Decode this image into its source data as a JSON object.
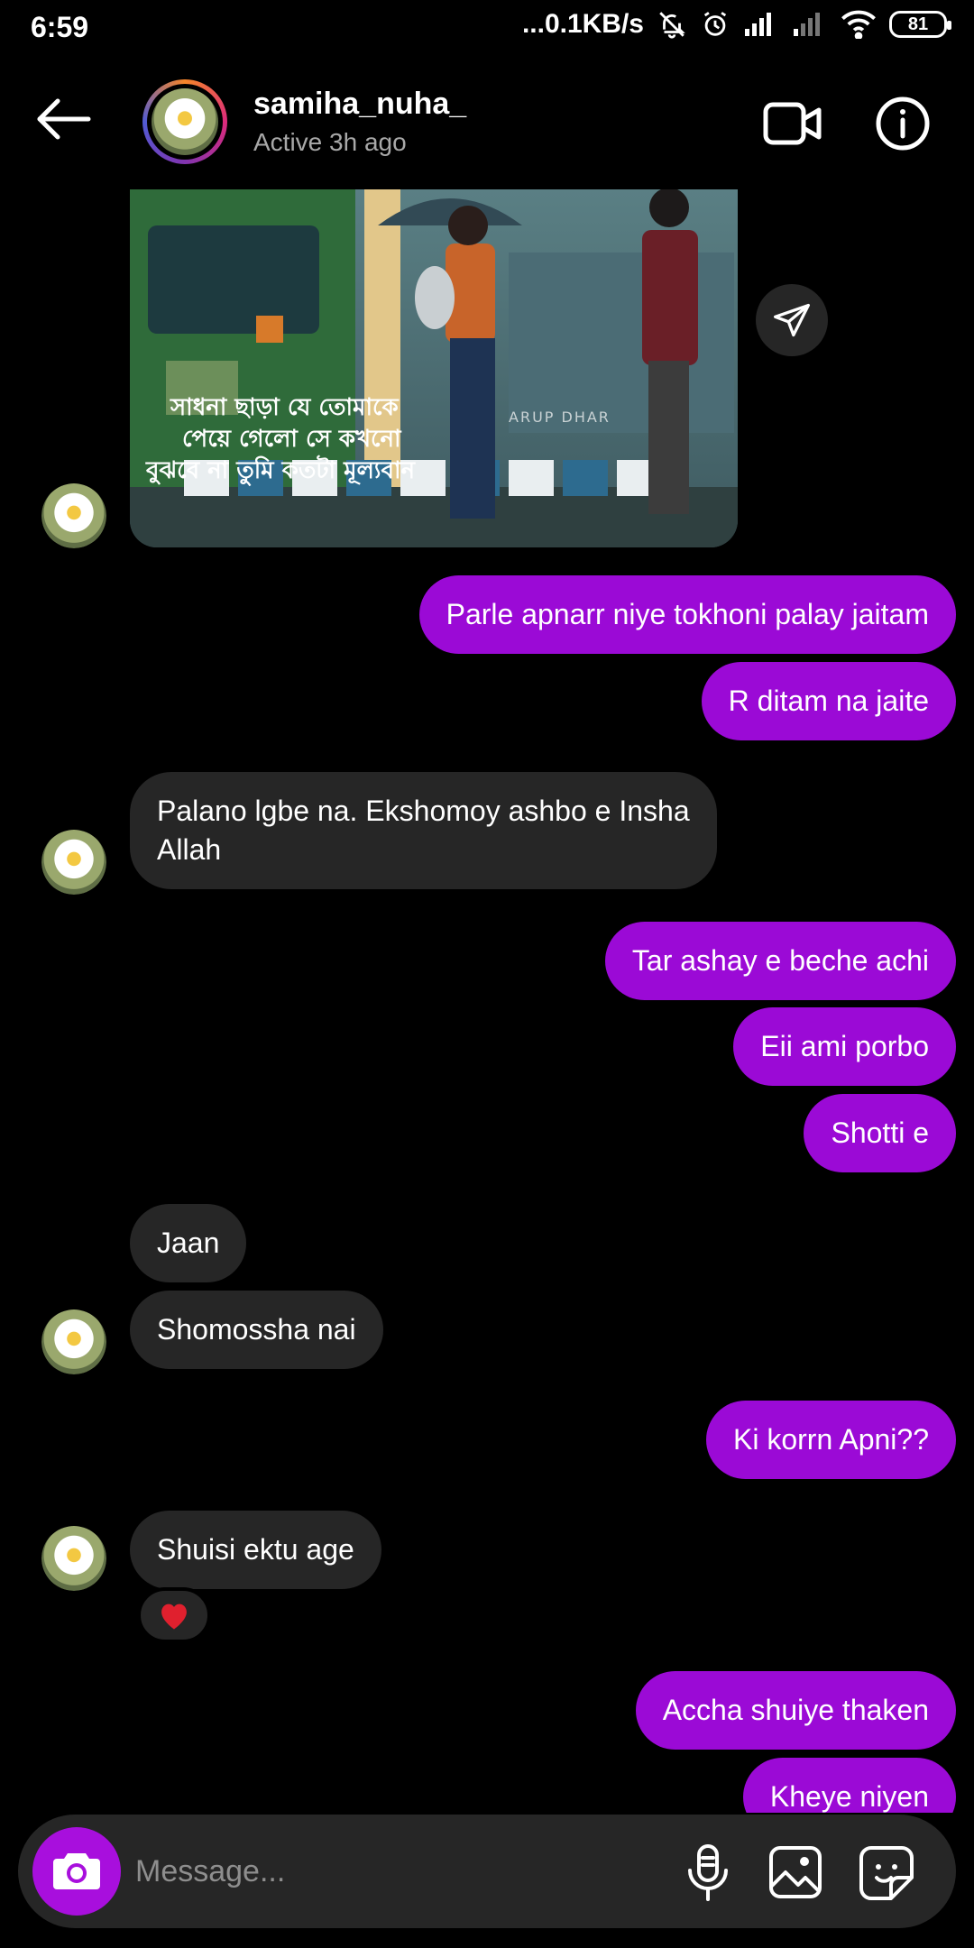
{
  "status_bar": {
    "time": "6:59",
    "net_speed": "...0.1KB/s",
    "battery": "81"
  },
  "header": {
    "username": "samiha_nuha_",
    "active_status": "Active 3h ago"
  },
  "shared_image": {
    "caption_line1": "সাধনা ছাড়া যে তোমাকে",
    "caption_line2": "পেয়ে গেলো সে কখনো",
    "caption_line3": "বুঝবে না তুমি কতটা মূল্যবান",
    "watermark": "ARUP DHAR"
  },
  "messages": [
    {
      "side": "sent",
      "text": "Parle apnarr niye tokhoni palay jaitam"
    },
    {
      "side": "sent",
      "text": "R ditam na jaite"
    },
    {
      "side": "received",
      "text_line1": "Palano lgbe na. Ekshomoy ashbo e Insha",
      "text_line2": "Allah"
    },
    {
      "side": "sent",
      "text": "Tar ashay e beche achi"
    },
    {
      "side": "sent",
      "text": "Eii ami porbo"
    },
    {
      "side": "sent",
      "text": "Shotti e"
    },
    {
      "side": "received",
      "text": "Jaan"
    },
    {
      "side": "received",
      "text": "Shomossha nai"
    },
    {
      "side": "sent",
      "text": "Ki korrn Apni??"
    },
    {
      "side": "received",
      "text": "Shuisi ektu age",
      "reaction": "❤️"
    },
    {
      "side": "sent",
      "text": "Accha shuiye thaken"
    },
    {
      "side": "sent",
      "text": "Kheye niyen"
    }
  ],
  "composer": {
    "placeholder": "Message..."
  },
  "colors": {
    "sent_bubble": "#9b0ad6",
    "received_bubble": "#262626",
    "camera_button": "#a80fdd"
  }
}
